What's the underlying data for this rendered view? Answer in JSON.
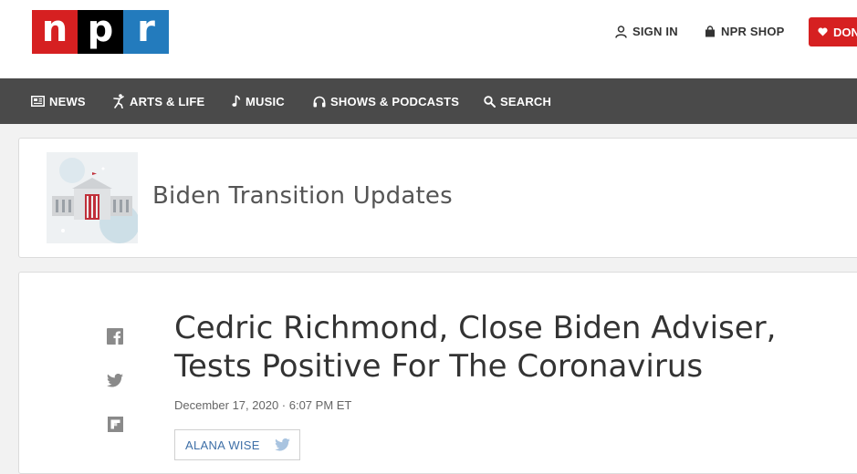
{
  "logo": {
    "letters": [
      "n",
      "p",
      "r"
    ],
    "colors": [
      "#d62021",
      "#000000",
      "#237bbd"
    ]
  },
  "header": {
    "sign_in": {
      "label": "SIGN IN",
      "icon": "user-icon"
    },
    "shop": {
      "label": "NPR SHOP",
      "icon": "bag-icon"
    },
    "donate": {
      "label": "DON",
      "icon": "heart-icon"
    }
  },
  "nav": {
    "items": [
      {
        "label": "NEWS",
        "icon": "news-icon"
      },
      {
        "label": "ARTS & LIFE",
        "icon": "dancer-icon"
      },
      {
        "label": "MUSIC",
        "icon": "music-note-icon"
      },
      {
        "label": "SHOWS & PODCASTS",
        "icon": "headphones-icon"
      },
      {
        "label": "SEARCH",
        "icon": "search-icon"
      }
    ]
  },
  "series": {
    "title": "Biden Transition Updates",
    "image": "white-house-illustration"
  },
  "article": {
    "headline": "Cedric Richmond, Close Biden Adviser, Tests Positive For The Coronavirus",
    "date": "December 17, 2020 · 6:07 PM ET",
    "author": "ALANA WISE",
    "author_icon": "twitter-icon"
  },
  "share": [
    "facebook-icon",
    "twitter-icon",
    "flipboard-icon"
  ],
  "colors": {
    "brand_red": "#d62021",
    "brand_blue": "#237bbd",
    "nav_bg": "#4a4a4a",
    "link_blue": "#3e6fa7"
  }
}
